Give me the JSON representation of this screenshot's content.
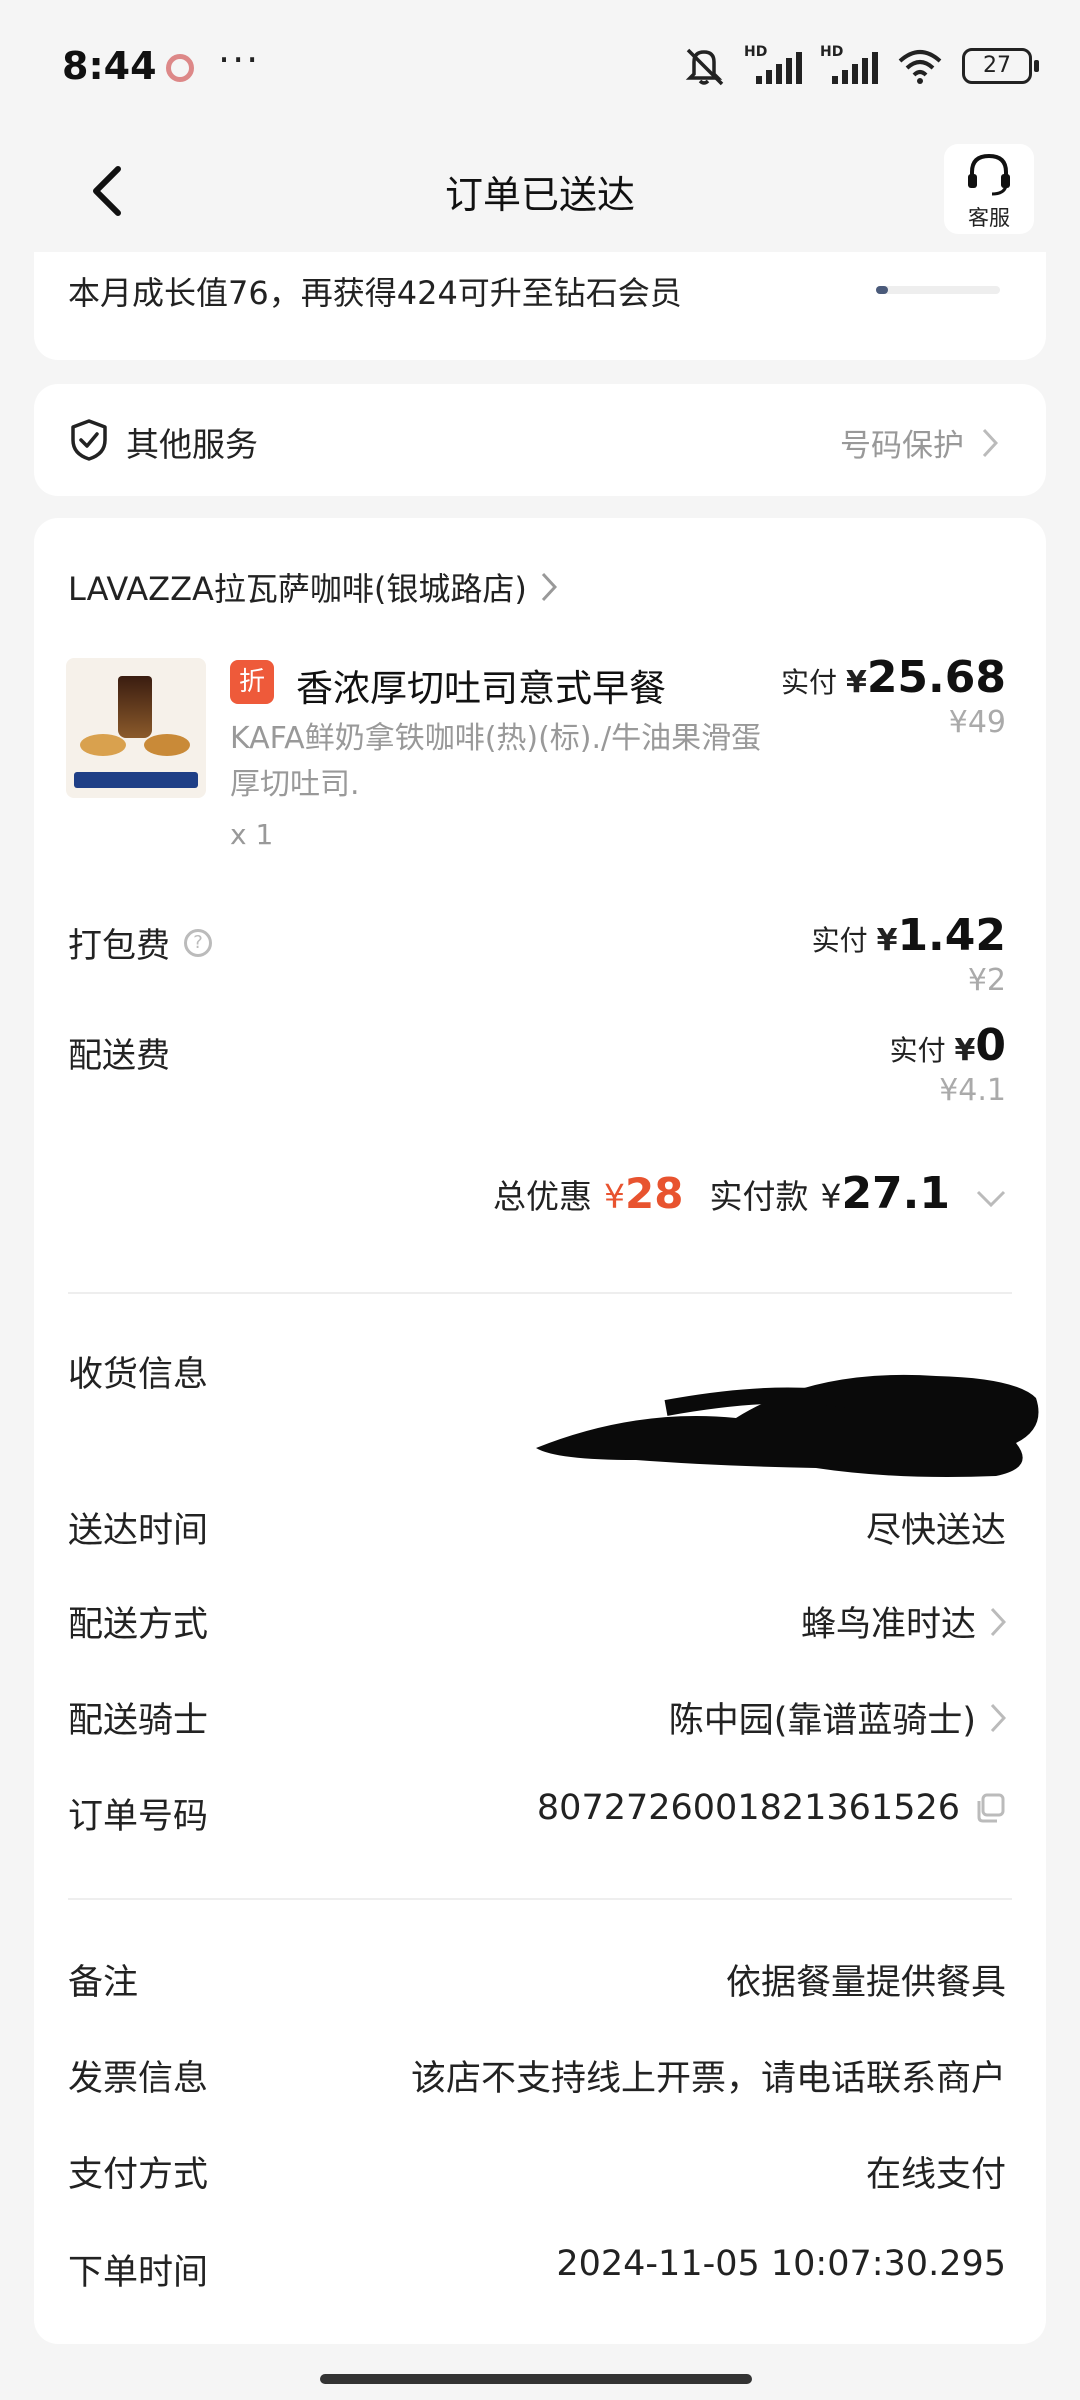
{
  "status_bar": {
    "time": "8:44",
    "more_dots": "···",
    "battery": "27"
  },
  "header": {
    "title": "订单已送达",
    "customer_service_label": "客服"
  },
  "membership": {
    "growth_text": "本月成长值76，再获得424可升至钻石会员",
    "progress_fraction": 0.1
  },
  "other_services": {
    "label": "其他服务",
    "value": "号码保护"
  },
  "order": {
    "shop_name": "LAVAZZA拉瓦萨咖啡(银城路店)",
    "item": {
      "discount_badge": "折",
      "name": "香浓厚切吐司意式早餐",
      "description": "KAFA鲜奶拿铁咖啡(热)(标)./牛油果滑蛋厚切吐司.",
      "quantity": "x 1",
      "paid_label": "实付",
      "currency": "¥",
      "paid_amount": "25.68",
      "original_price": "¥49"
    },
    "fees": [
      {
        "label": "打包费",
        "paid_label": "实付",
        "currency": "¥",
        "paid": "1.42",
        "original": "¥2",
        "has_help": true
      },
      {
        "label": "配送费",
        "paid_label": "实付",
        "currency": "¥",
        "paid": "0",
        "original": "¥4.1",
        "has_help": false
      }
    ],
    "summary": {
      "discount_label": "总优惠",
      "discount_currency": "¥",
      "discount_amount": "28",
      "paid_label": "实付款",
      "paid_currency": "¥",
      "paid_amount": "27.1"
    }
  },
  "delivery_info": [
    {
      "label": "收货信息",
      "value": ""
    },
    {
      "label": "送达时间",
      "value": "尽快送达"
    },
    {
      "label": "配送方式",
      "value": "蜂鸟准时达"
    },
    {
      "label": "配送骑士",
      "value": "陈中园(靠谱蓝骑士)"
    },
    {
      "label": "订单号码",
      "value": "8072726001821361526"
    }
  ],
  "extra_info": [
    {
      "label": "备注",
      "value": "依据餐量提供餐具"
    },
    {
      "label": "发票信息",
      "value": "该店不支持线上开票，请电话联系商户"
    },
    {
      "label": "支付方式",
      "value": "在线支付"
    },
    {
      "label": "下单时间",
      "value": "2024-11-05 10:07:30.295"
    }
  ],
  "colors": {
    "accent_red": "#e8532f",
    "badge_red": "#ee5a3a",
    "background": "#f5f5f5"
  }
}
